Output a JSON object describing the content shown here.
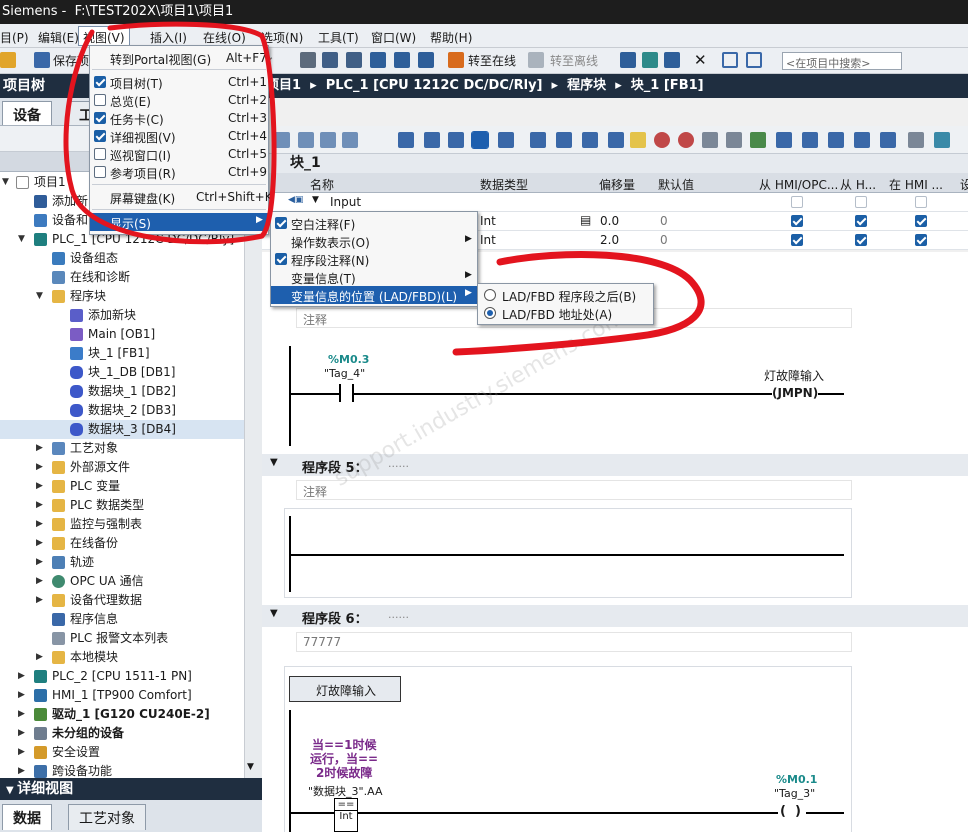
{
  "title": {
    "app": "Siemens",
    "path": "F:\\TEST202X\\项目1\\项目1"
  },
  "menubar": [
    "目(P)",
    "编辑(E)",
    "视图(V)",
    "插入(I)",
    "在线(O)",
    "选项(N)",
    "工具(T)",
    "窗口(W)",
    "帮助(H)"
  ],
  "toolbar": {
    "save": "保存项",
    "go_online": "转至在线",
    "go_offline": "转至离线",
    "search_placeholder": "<在项目中搜索>"
  },
  "project_tree": {
    "title": "项目树",
    "tab_devices": "设备",
    "tab2": "工",
    "header": "",
    "items": [
      {
        "label": "项目1",
        "icon": "project-icon"
      },
      {
        "label": "添加新",
        "icon": "add-device-icon"
      },
      {
        "label": "设备和",
        "icon": "devices-networks-icon"
      },
      {
        "label": "PLC_1 [CPU 1212C DC/DC/Rly]",
        "icon": "plc-icon"
      },
      {
        "label": "设备组态",
        "icon": "device-config-icon"
      },
      {
        "label": "在线和诊断",
        "icon": "diagnostics-icon"
      },
      {
        "label": "程序块",
        "icon": "folder-icon"
      },
      {
        "label": "添加新块",
        "icon": "add-block-icon"
      },
      {
        "label": "Main [OB1]",
        "icon": "ob-icon"
      },
      {
        "label": "块_1 [FB1]",
        "icon": "fb-icon"
      },
      {
        "label": "块_1_DB [DB1]",
        "icon": "db-icon"
      },
      {
        "label": "数据块_1 [DB2]",
        "icon": "db-icon"
      },
      {
        "label": "数据块_2 [DB3]",
        "icon": "db-icon"
      },
      {
        "label": "数据块_3 [DB4]",
        "icon": "db-icon"
      },
      {
        "label": "工艺对象",
        "icon": "folder-icon"
      },
      {
        "label": "外部源文件",
        "icon": "folder-icon"
      },
      {
        "label": "PLC 变量",
        "icon": "folder-icon"
      },
      {
        "label": "PLC 数据类型",
        "icon": "folder-icon"
      },
      {
        "label": "监控与强制表",
        "icon": "folder-icon"
      },
      {
        "label": "在线备份",
        "icon": "folder-icon"
      },
      {
        "label": "轨迹",
        "icon": "trace-icon"
      },
      {
        "label": "OPC UA 通信",
        "icon": "opcua-icon"
      },
      {
        "label": "设备代理数据",
        "icon": "folder-icon"
      },
      {
        "label": "程序信息",
        "icon": "program-info-icon"
      },
      {
        "label": "PLC 报警文本列表",
        "icon": "alarm-text-icon"
      },
      {
        "label": "本地模块",
        "icon": "folder-icon"
      },
      {
        "label": "PLC_2 [CPU 1511-1 PN]",
        "icon": "plc-icon"
      },
      {
        "label": "HMI_1 [TP900 Comfort]",
        "icon": "hmi-icon"
      },
      {
        "label": "驱动_1 [G120 CU240E-2]",
        "icon": "drive-icon"
      },
      {
        "label": "未分组的设备",
        "icon": "ungrouped-icon"
      },
      {
        "label": "安全设置",
        "icon": "security-icon"
      },
      {
        "label": "跨设备功能",
        "icon": "cross-device-icon"
      }
    ]
  },
  "detail_view": {
    "title": "详细视图",
    "tab_data": "数据",
    "tab_tech": "工艺对象"
  },
  "breadcrumb": [
    "项目1",
    "PLC_1 [CPU 1212C DC/DC/Rly]",
    "程序块",
    "块_1 [FB1]"
  ],
  "block": {
    "name": "块_1"
  },
  "interface": {
    "headers": [
      "名称",
      "数据类型",
      "偏移量",
      "默认值",
      "从 HMI/OPC...",
      "从 H...",
      "在 HMI ...",
      "设"
    ],
    "section": "Input",
    "rows": [
      {
        "type": "Int",
        "offset": "0.0",
        "default": "0"
      },
      {
        "type": "Int",
        "offset": "2.0",
        "default": "0"
      }
    ]
  },
  "view_menu": {
    "items": [
      {
        "label": "转到Portal视图(G)",
        "key": "Alt+F7",
        "checked": null
      },
      {
        "label": "项目树(T)",
        "key": "Ctrl+1",
        "checked": true
      },
      {
        "label": "总览(E)",
        "key": "Ctrl+2",
        "checked": false
      },
      {
        "label": "任务卡(C)",
        "key": "Ctrl+3",
        "checked": true
      },
      {
        "label": "详细视图(V)",
        "key": "Ctrl+4",
        "checked": true
      },
      {
        "label": "巡视窗口(I)",
        "key": "Ctrl+5",
        "checked": false
      },
      {
        "label": "参考项目(R)",
        "key": "Ctrl+9",
        "checked": false
      },
      {
        "label": "屏幕键盘(K)",
        "key": "Ctrl+Shift+K",
        "checked": null
      },
      {
        "label": "显示(S)",
        "key": "",
        "checked": null
      }
    ]
  },
  "show_submenu": {
    "items": [
      "空白注释(F)",
      "操作数表示(O)",
      "程序段注释(N)",
      "变量信息(T)",
      "变量信息的位置 (LAD/FBD)(L)"
    ]
  },
  "position_submenu": {
    "items": [
      "LAD/FBD 程序段之后(B)",
      "LAD/FBD 地址处(A)"
    ],
    "selected": 1
  },
  "networks": [
    {
      "title": "",
      "comment": "注释",
      "contact_addr": "%M0.3",
      "contact_tag": "\"Tag_4\"",
      "coil_name": "灯故障输入",
      "coil_op": "JMPN"
    },
    {
      "title": "程序段 5：",
      "comment": "注释"
    },
    {
      "title": "程序段 6：",
      "comment": "77777",
      "label_box": "灯故障输入",
      "purple": [
        "当==1时候",
        "运行，当==",
        "2时候故障"
      ],
      "cmp_tag": "\"数据块_3\".AA",
      "cmp_op": "==",
      "cmp_type": "Int",
      "coil_addr": "%M0.1",
      "coil_tag": "\"Tag_3\""
    }
  ],
  "dots": "......",
  "watermark": "support.industry.siemens.com/cs",
  "annotation_color": "#e3141e"
}
